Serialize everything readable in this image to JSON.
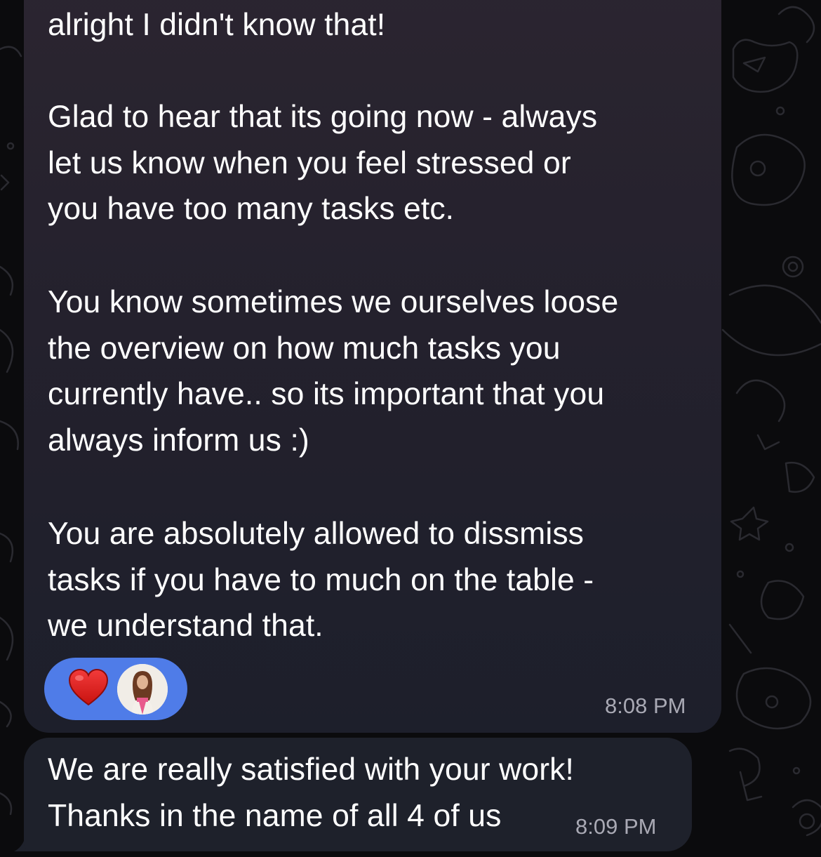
{
  "conversation": {
    "messages": [
      {
        "paragraphs": [
          "alright I didn't know that!",
          "Glad to hear that its going now - always\nlet us know when you feel stressed or\nyou have too many tasks etc.",
          "You know sometimes we ourselves loose\nthe overview on how much tasks you\ncurrently have.. so its important that you\nalways inform us :)",
          "You are absolutely allowed to dissmiss\ntasks if you have to much on the table -\nwe understand that."
        ],
        "time": "8:08 PM",
        "reaction": {
          "emoji": "heart-icon",
          "color": "#e0201e",
          "pill_color": "#4f7ce8"
        }
      },
      {
        "text": "We are really satisfied with your work!\nThanks in the name of all 4 of us",
        "time": "8:09 PM"
      }
    ]
  },
  "colors": {
    "background": "#0b0b0d",
    "bubble": "#24212d",
    "text": "#ffffff",
    "timestamp": "#a9a9b4"
  }
}
